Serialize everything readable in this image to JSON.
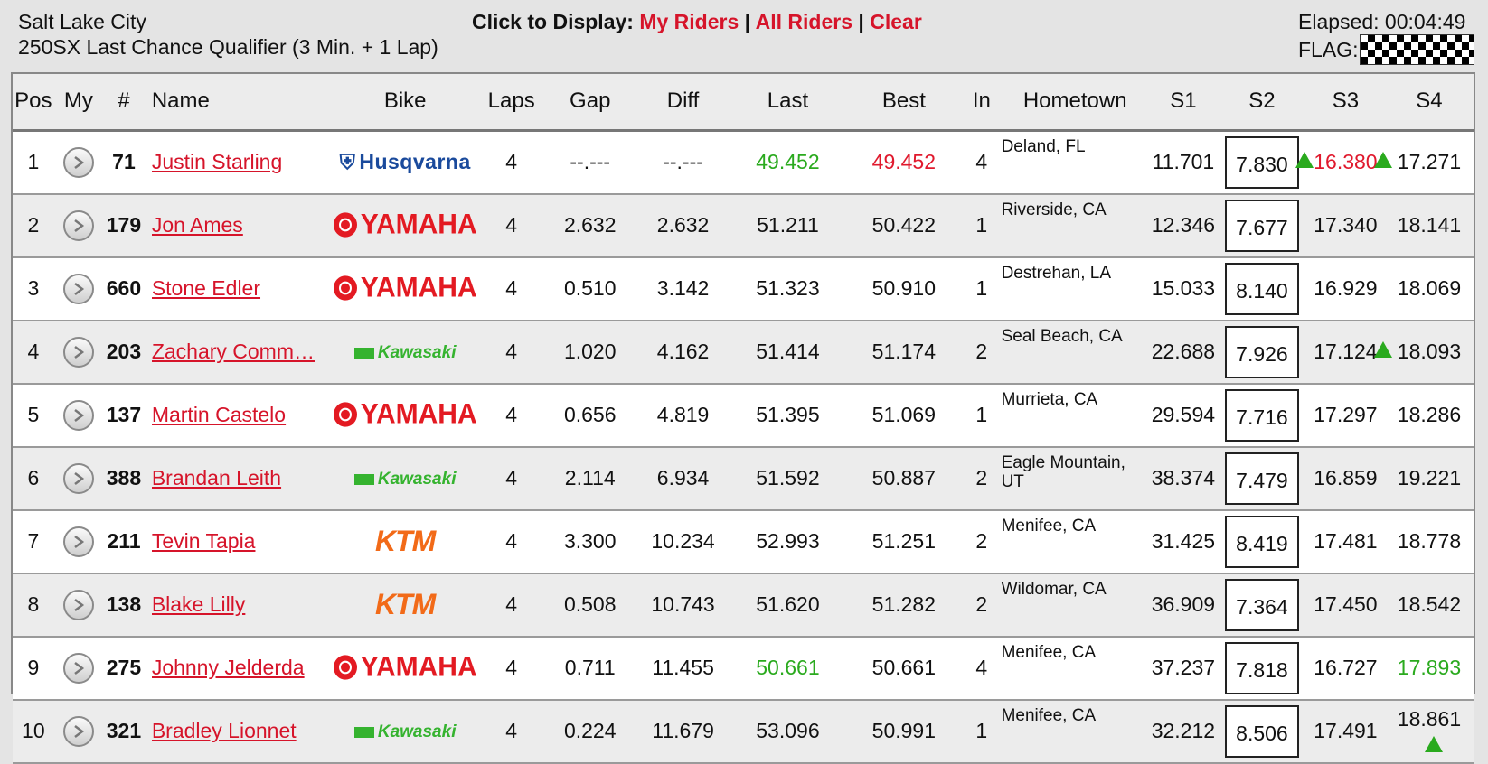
{
  "header": {
    "venue": "Salt Lake City",
    "race": "250SX Last Chance Qualifier (3 Min. + 1 Lap)",
    "click_label": "Click to Display:",
    "links": {
      "my_riders": "My Riders",
      "all_riders": "All Riders",
      "clear": "Clear"
    },
    "separator": "|",
    "elapsed": "Elapsed: 00:04:49",
    "flag_label": "FLAG:",
    "flag_icon": "checkered-flag-icon"
  },
  "columns": [
    "Pos",
    "My",
    "#",
    "Name",
    "Bike",
    "Laps",
    "Gap",
    "Diff",
    "Last",
    "Best",
    "In",
    "Hometown",
    "S1",
    "S2",
    "S3",
    "S4"
  ],
  "colors": {
    "link_red": "#d6142a",
    "fast_green": "#2aaa1e",
    "best_red": "#e0192d"
  },
  "riders": [
    {
      "pos": "1",
      "num": "71",
      "name": "Justin Starling",
      "bike": "Husqvarna",
      "laps": "4",
      "gap": "--.---",
      "diff": "--.---",
      "last": "49.452",
      "best": "49.452",
      "in": "4",
      "hometown": "Deland, FL",
      "s1": "11.701",
      "s2": "7.830",
      "s3": "16.380",
      "s4": "17.271"
    },
    {
      "pos": "2",
      "num": "179",
      "name": "Jon Ames",
      "bike": "YAMAHA",
      "laps": "4",
      "gap": "2.632",
      "diff": "2.632",
      "last": "51.211",
      "best": "50.422",
      "in": "1",
      "hometown": "Riverside, CA",
      "s1": "12.346",
      "s2": "7.677",
      "s3": "17.340",
      "s4": "18.141"
    },
    {
      "pos": "3",
      "num": "660",
      "name": "Stone Edler",
      "bike": "YAMAHA",
      "laps": "4",
      "gap": "0.510",
      "diff": "3.142",
      "last": "51.323",
      "best": "50.910",
      "in": "1",
      "hometown": "Destrehan, LA",
      "s1": "15.033",
      "s2": "8.140",
      "s3": "16.929",
      "s4": "18.069"
    },
    {
      "pos": "4",
      "num": "203",
      "name": "Zachary Comm…",
      "bike": "Kawasaki",
      "laps": "4",
      "gap": "1.020",
      "diff": "4.162",
      "last": "51.414",
      "best": "51.174",
      "in": "2",
      "hometown": "Seal Beach, CA",
      "s1": "22.688",
      "s2": "7.926",
      "s3": "17.124",
      "s4": "18.093"
    },
    {
      "pos": "5",
      "num": "137",
      "name": "Martin Castelo",
      "bike": "YAMAHA",
      "laps": "4",
      "gap": "0.656",
      "diff": "4.819",
      "last": "51.395",
      "best": "51.069",
      "in": "1",
      "hometown": "Murrieta, CA",
      "s1": "29.594",
      "s2": "7.716",
      "s3": "17.297",
      "s4": "18.286"
    },
    {
      "pos": "6",
      "num": "388",
      "name": "Brandan Leith",
      "bike": "Kawasaki",
      "laps": "4",
      "gap": "2.114",
      "diff": "6.934",
      "last": "51.592",
      "best": "50.887",
      "in": "2",
      "hometown": "Eagle Mountain, UT",
      "s1": "38.374",
      "s2": "7.479",
      "s3": "16.859",
      "s4": "19.221"
    },
    {
      "pos": "7",
      "num": "211",
      "name": "Tevin Tapia",
      "bike": "KTM",
      "laps": "4",
      "gap": "3.300",
      "diff": "10.234",
      "last": "52.993",
      "best": "51.251",
      "in": "2",
      "hometown": "Menifee, CA",
      "s1": "31.425",
      "s2": "8.419",
      "s3": "17.481",
      "s4": "18.778"
    },
    {
      "pos": "8",
      "num": "138",
      "name": "Blake Lilly",
      "bike": "KTM",
      "laps": "4",
      "gap": "0.508",
      "diff": "10.743",
      "last": "51.620",
      "best": "51.282",
      "in": "2",
      "hometown": "Wildomar, CA",
      "s1": "36.909",
      "s2": "7.364",
      "s3": "17.450",
      "s4": "18.542"
    },
    {
      "pos": "9",
      "num": "275",
      "name": "Johnny Jelderda",
      "bike": "YAMAHA",
      "laps": "4",
      "gap": "0.711",
      "diff": "11.455",
      "last": "50.661",
      "best": "50.661",
      "in": "4",
      "hometown": "Menifee, CA",
      "s1": "37.237",
      "s2": "7.818",
      "s3": "16.727",
      "s4": "17.893"
    },
    {
      "pos": "10",
      "num": "321",
      "name": "Bradley Lionnet",
      "bike": "Kawasaki",
      "laps": "4",
      "gap": "0.224",
      "diff": "11.679",
      "last": "53.096",
      "best": "50.991",
      "in": "1",
      "hometown": "Menifee, CA",
      "s1": "32.212",
      "s2": "8.506",
      "s3": "17.491",
      "s4": "18.861"
    }
  ]
}
